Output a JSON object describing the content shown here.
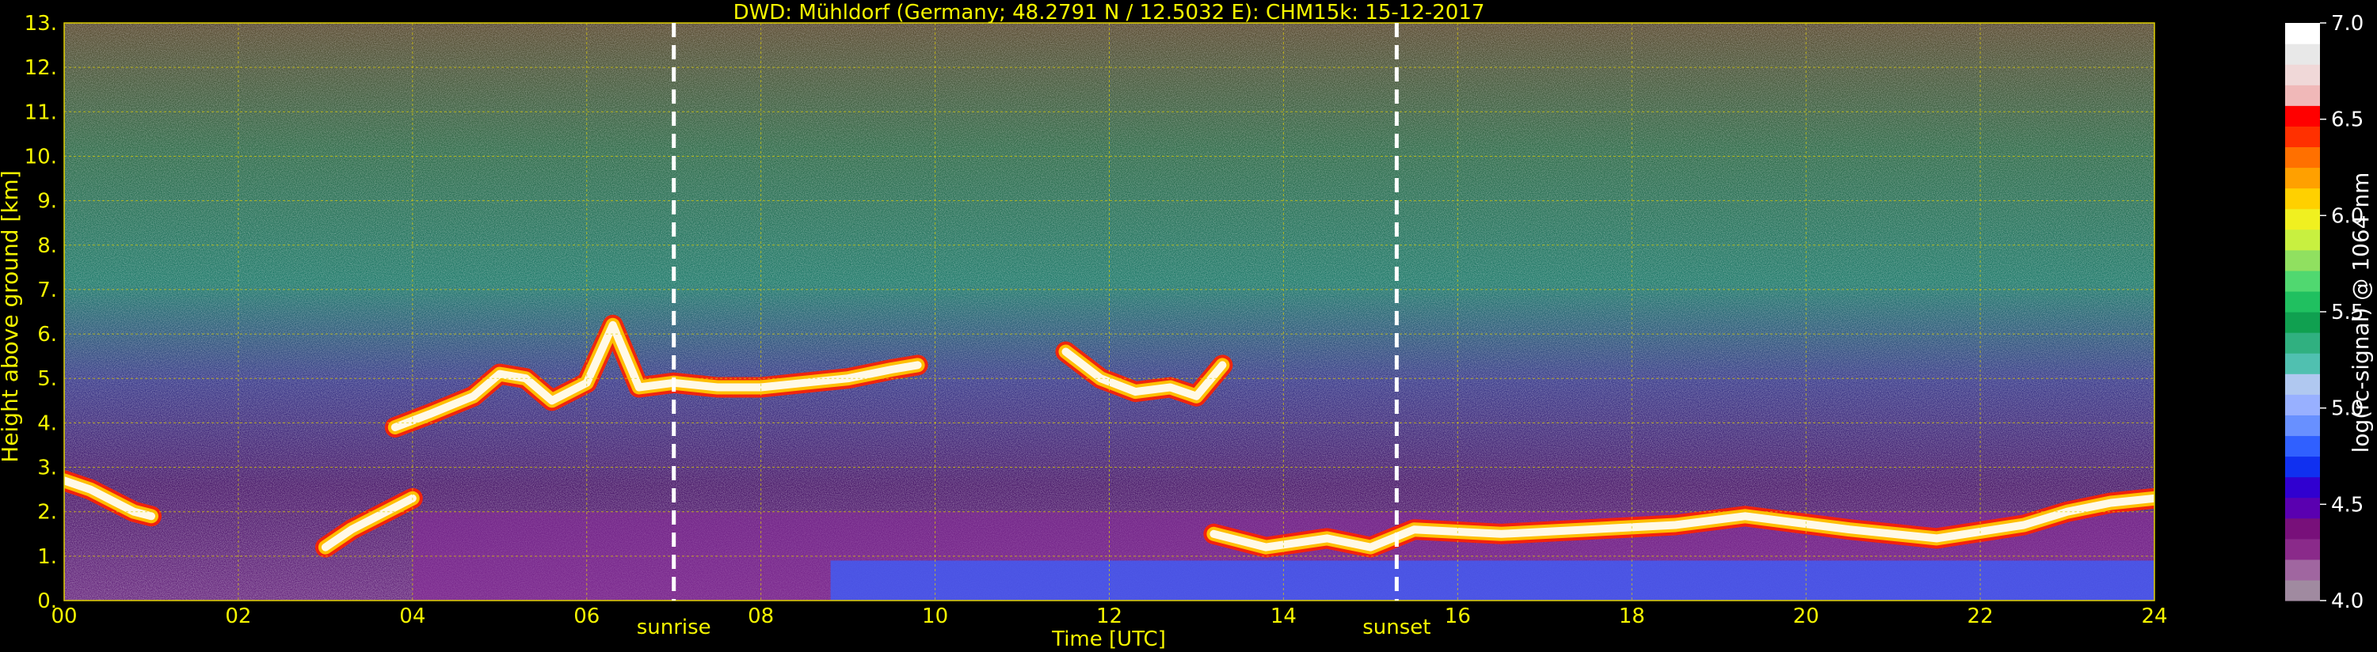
{
  "chart_data": {
    "type": "heatmap",
    "title": "DWD: Mühldorf (Germany; 48.2791 N / 12.5032 E):    CHM15k: 15-12-2017",
    "xlabel": "Time [UTC]",
    "ylabel": "Height above ground [km]",
    "xlim": [
      0,
      24
    ],
    "ylim": [
      0,
      13
    ],
    "x_ticks": [
      "00",
      "02",
      "04",
      "06",
      "08",
      "10",
      "12",
      "14",
      "16",
      "18",
      "20",
      "22",
      "24"
    ],
    "y_ticks": [
      "0.",
      "1.",
      "2.",
      "3.",
      "4.",
      "5.",
      "6.",
      "7.",
      "8.",
      "9.",
      "10.",
      "11.",
      "12.",
      "13."
    ],
    "grid": true,
    "markers": [
      {
        "label": "sunrise",
        "x": 7.0
      },
      {
        "label": "sunset",
        "x": 15.3
      }
    ],
    "colorbar": {
      "label": "log(rc-signal) @ 1064 nm",
      "range": [
        4.0,
        7.0
      ],
      "ticks": [
        "4.0",
        "4.5",
        "5.0",
        "5.5",
        "6.0",
        "6.5",
        "7.0"
      ],
      "colors": [
        "#a08aa0",
        "#a066a0",
        "#8a2a8a",
        "#78107a",
        "#5a00b0",
        "#3000d0",
        "#1030f0",
        "#3060ff",
        "#6890ff",
        "#98b0ff",
        "#b0c8f0",
        "#50c0b0",
        "#30b080",
        "#10a050",
        "#20c060",
        "#50d870",
        "#90e060",
        "#c8f040",
        "#f0f020",
        "#ffd000",
        "#ffa000",
        "#ff7000",
        "#ff3000",
        "#ff0000",
        "#f0b8b8",
        "#f0d8d8",
        "#e8e8e8",
        "#ffffff"
      ]
    },
    "layers": [
      {
        "name": "cloud_layer",
        "points": [
          [
            3.8,
            3.9
          ],
          [
            4.2,
            4.2
          ],
          [
            4.7,
            4.6
          ],
          [
            5.0,
            5.1
          ],
          [
            5.3,
            5.0
          ],
          [
            5.6,
            4.5
          ],
          [
            6.0,
            4.9
          ],
          [
            6.3,
            6.2
          ],
          [
            6.6,
            4.8
          ],
          [
            7.0,
            4.9
          ],
          [
            7.5,
            4.8
          ],
          [
            8.0,
            4.8
          ],
          [
            8.5,
            4.9
          ],
          [
            9.0,
            5.0
          ],
          [
            9.5,
            5.2
          ],
          [
            9.8,
            5.3
          ]
        ]
      },
      {
        "name": "cloud_patch",
        "points": [
          [
            11.5,
            5.6
          ],
          [
            11.9,
            5.0
          ],
          [
            12.3,
            4.7
          ],
          [
            12.7,
            4.8
          ],
          [
            13.0,
            4.6
          ],
          [
            13.3,
            5.3
          ]
        ]
      },
      {
        "name": "low_layer",
        "points": [
          [
            3.0,
            1.2
          ],
          [
            3.3,
            1.6
          ],
          [
            3.7,
            2.0
          ],
          [
            4.0,
            2.3
          ]
        ]
      },
      {
        "name": "boundary_layer",
        "points": [
          [
            13.2,
            1.5
          ],
          [
            13.8,
            1.2
          ],
          [
            14.5,
            1.4
          ],
          [
            15.0,
            1.2
          ],
          [
            15.5,
            1.6
          ],
          [
            16.5,
            1.5
          ],
          [
            17.5,
            1.6
          ],
          [
            18.5,
            1.7
          ],
          [
            19.3,
            1.9
          ],
          [
            20.5,
            1.6
          ],
          [
            21.5,
            1.4
          ],
          [
            22.5,
            1.7
          ],
          [
            23.0,
            2.0
          ],
          [
            23.5,
            2.2
          ],
          [
            24.0,
            2.3
          ]
        ]
      },
      {
        "name": "early_layer",
        "points": [
          [
            0.0,
            2.7
          ],
          [
            0.3,
            2.5
          ],
          [
            0.6,
            2.2
          ],
          [
            0.8,
            2.0
          ],
          [
            1.0,
            1.9
          ]
        ]
      }
    ]
  }
}
